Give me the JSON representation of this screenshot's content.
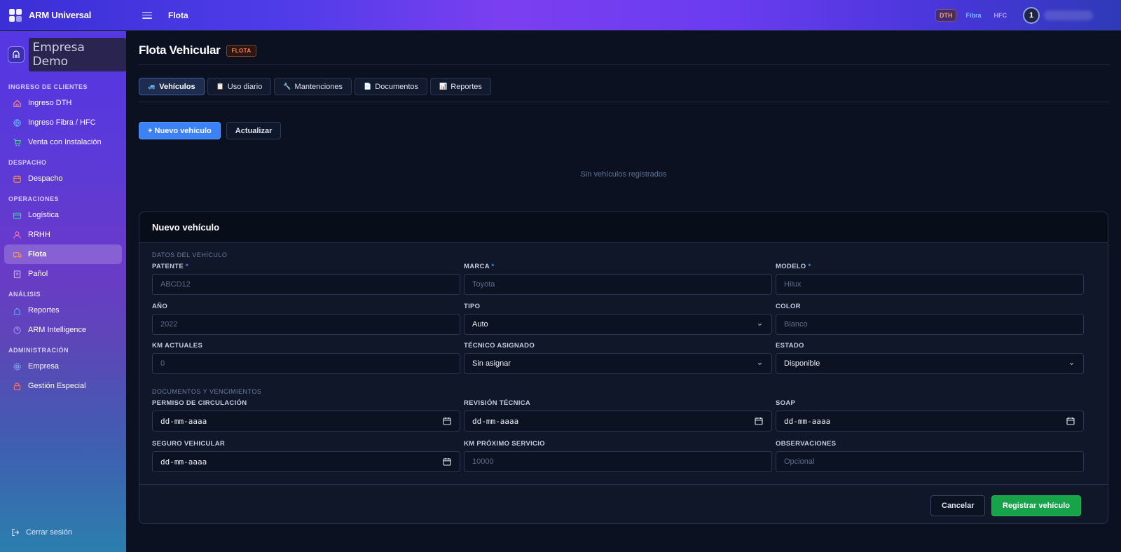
{
  "app": {
    "name": "ARM Universal",
    "page": "Flota"
  },
  "topbar": {
    "chips": [
      "DTH",
      "Fibra",
      "HFC"
    ],
    "avatar_initial": "1"
  },
  "sidebar": {
    "company": "Empresa Demo",
    "sections": [
      {
        "title": "INGRESO DE CLIENTES",
        "items": [
          "Ingreso DTH",
          "Ingreso Fibra / HFC",
          "Venta con Instalación"
        ]
      },
      {
        "title": "DESPACHO",
        "items": [
          "Despacho"
        ]
      },
      {
        "title": "OPERACIONES",
        "items": [
          "Logística",
          "RRHH",
          "Flota",
          "Pañol"
        ]
      },
      {
        "title": "ANÁLISIS",
        "items": [
          "Reportes",
          "ARM Intelligence"
        ]
      },
      {
        "title": "ADMINISTRACIÓN",
        "items": [
          "Empresa",
          "Gestión Especial"
        ]
      }
    ],
    "active_item": "Flota",
    "logout": "Cerrar sesión"
  },
  "main": {
    "title": "Flota Vehicular",
    "badge": "FLOTA",
    "tabs": [
      {
        "label": "Vehículos",
        "icon": "🚙"
      },
      {
        "label": "Uso diario",
        "icon": "📋"
      },
      {
        "label": "Mantenciones",
        "icon": "🔧"
      },
      {
        "label": "Documentos",
        "icon": "📄"
      },
      {
        "label": "Reportes",
        "icon": "📊"
      }
    ],
    "actions": {
      "new": "+ Nuevo vehículo",
      "refresh": "Actualizar"
    },
    "empty": "Sin vehículos registrados"
  },
  "form": {
    "title": "Nuevo vehículo",
    "section_vehicle": "DATOS DEL VEHÍCULO",
    "section_docs": "DOCUMENTOS Y VENCIMIENTOS",
    "patente": {
      "label": "PATENTE",
      "placeholder": "ABCD12"
    },
    "marca": {
      "label": "MARCA",
      "placeholder": "Toyota"
    },
    "modelo": {
      "label": "MODELO",
      "placeholder": "Hilux"
    },
    "anio": {
      "label": "AÑO",
      "placeholder": "2022"
    },
    "tipo": {
      "label": "TIPO",
      "value": "Auto"
    },
    "color": {
      "label": "COLOR",
      "placeholder": "Blanco"
    },
    "km": {
      "label": "KM ACTUALES",
      "placeholder": "0"
    },
    "tecnico": {
      "label": "TÉCNICO ASIGNADO",
      "value": "Sin asignar"
    },
    "estado": {
      "label": "ESTADO",
      "value": "Disponible"
    },
    "permiso": {
      "label": "PERMISO DE CIRCULACIÓN",
      "value": "dd-mm-aaaa"
    },
    "revision": {
      "label": "REVISIÓN TÉCNICA",
      "value": "dd-mm-aaaa"
    },
    "soap": {
      "label": "SOAP",
      "value": "dd-mm-aaaa"
    },
    "seguro": {
      "label": "SEGURO VEHICULAR",
      "value": "dd-mm-aaaa"
    },
    "km_servicio": {
      "label": "KM PRÓXIMO SERVICIO",
      "placeholder": "10000"
    },
    "observaciones": {
      "label": "OBSERVACIONES",
      "placeholder": "Opcional"
    },
    "required_mark": "*",
    "cancel": "Cancelar",
    "submit": "Registrar vehículo"
  },
  "colors": {
    "accent": "#3b82f6",
    "success": "#16a34a",
    "badge": "#fb7b51"
  }
}
